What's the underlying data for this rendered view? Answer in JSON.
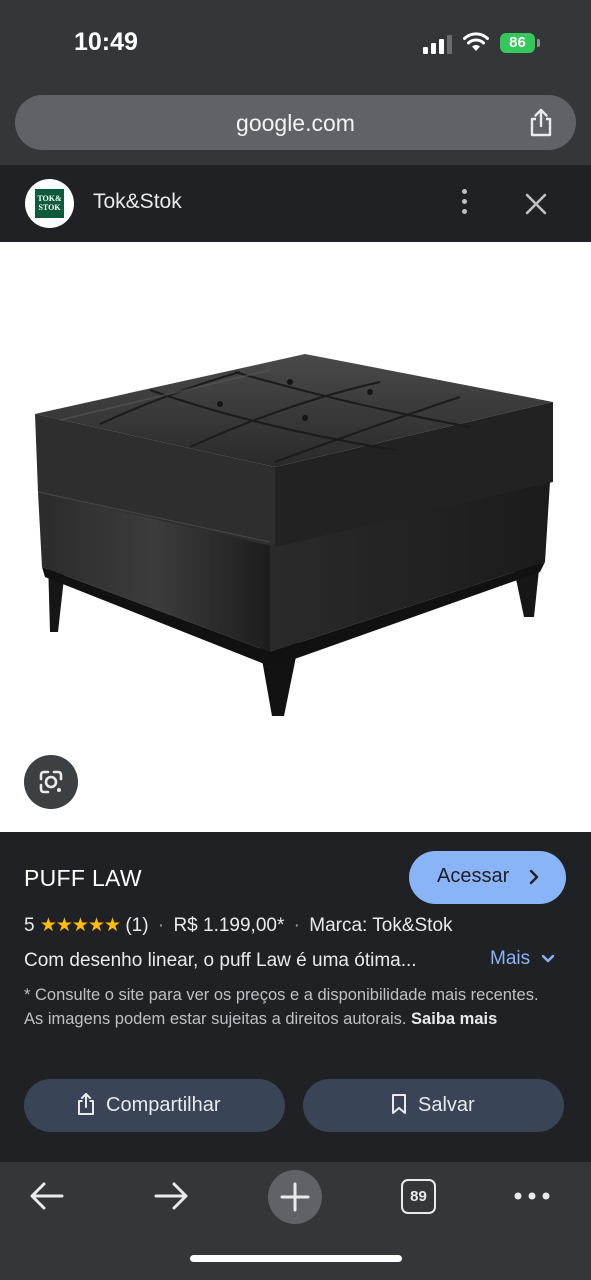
{
  "status_bar": {
    "time": "10:49",
    "battery": "86"
  },
  "url_bar": {
    "url": "google.com",
    "share_icon": "share-icon"
  },
  "site_header": {
    "logo_text_line1": "TOK&",
    "logo_text_line2": "STOK",
    "site_name": "Tok&Stok",
    "more_icon": "more-vertical-icon",
    "close_icon": "close-icon"
  },
  "image": {
    "alt": "PUFF LAW",
    "lens_icon": "google-lens-icon"
  },
  "product": {
    "title": "PUFF LAW",
    "visit_label": "Acessar",
    "rating": "5",
    "stars": "★★★★★",
    "review_count": "(1)",
    "price": "R$ 1.199,00*",
    "brand": "Marca: Tok&Stok",
    "description": "Com desenho linear, o puff Law é uma ótima...",
    "more_label": "Mais",
    "disclaimer": "* Consulte o site para ver os preços e a disponibilidade mais recentes. As imagens podem estar sujeitas a direitos autorais.",
    "learn_more": "Saiba mais",
    "share_label": "Compartilhar",
    "save_label": "Salvar"
  },
  "bottom_bar": {
    "tab_count": "89"
  },
  "colors": {
    "accent": "#8ab4f8",
    "star": "#fbbc04",
    "brand_green": "#0d5b3a",
    "pill_bg": "#394457"
  }
}
